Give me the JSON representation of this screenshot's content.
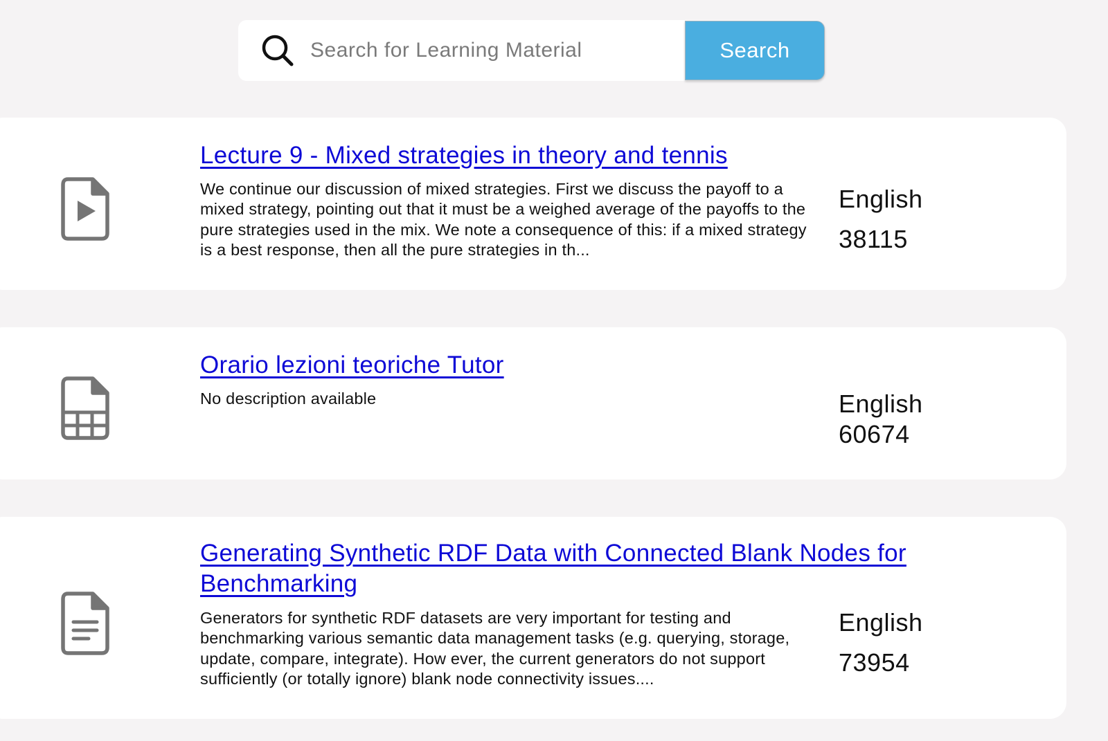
{
  "search": {
    "placeholder": "Search for Learning Material",
    "value": "",
    "button_label": "Search",
    "icon": "search-icon"
  },
  "colors": {
    "background": "#f5f3f4",
    "card": "#ffffff",
    "link": "#0d09d6",
    "button": "#4aaee0",
    "icon": "#757575"
  },
  "results": [
    {
      "icon": "video-file-icon",
      "title": "Lecture 9 - Mixed strategies in theory and tennis",
      "description": "We continue our discussion of mixed strategies. First we discuss the payoff to a mixed strategy, pointing out that it must be a weighed average of the payoffs to the pure strategies used in the mix. We note a consequence of this: if a mixed strategy is a best response, then all the pure strategies in th...",
      "language": "English",
      "id": "38115"
    },
    {
      "icon": "spreadsheet-file-icon",
      "title": "Orario lezioni teoriche Tutor",
      "description": "No description available",
      "language": "English",
      "id": "60674"
    },
    {
      "icon": "text-document-icon",
      "title": "Generating Synthetic RDF Data with Connected Blank Nodes for Benchmarking",
      "description": "Generators for synthetic RDF datasets are very important for testing and benchmarking various semantic data management tasks (e.g. querying, storage, update, compare, integrate). How ever, the current generators do not support sufficiently (or totally ignore) blank node connectivity issues....",
      "language": "English",
      "id": "73954"
    }
  ]
}
